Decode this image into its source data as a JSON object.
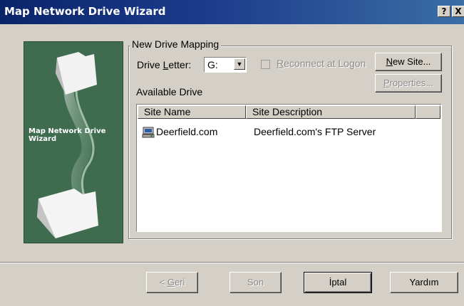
{
  "window": {
    "title": "Map Network Drive Wizard",
    "help_button": "?",
    "close_button": "X"
  },
  "side_panel": {
    "label": "Map Network Drive Wizard",
    "background_color": "#3f6b4f"
  },
  "group": {
    "title": "New Drive Mapping",
    "drive_letter_label_before": "Drive ",
    "drive_letter_label_hotkey": "L",
    "drive_letter_label_after": "etter:",
    "drive_letter_value": "G:",
    "reconnect_hotkey": "R",
    "reconnect_label": "econnect at Logon",
    "reconnect_checked": false,
    "new_site_hotkey": "N",
    "new_site_label": "ew Site...",
    "properties_hotkey": "P",
    "properties_label": "roperties...",
    "available_drive_label": "Available Drive"
  },
  "list": {
    "columns": [
      "Site Name",
      "Site Description"
    ],
    "rows": [
      {
        "icon": "network-drive-icon",
        "site_name": "Deerfield.com",
        "site_description": "Deerfield.com's FTP Server"
      }
    ]
  },
  "footer": {
    "back_prefix": "< ",
    "back_hotkey": "G",
    "back_label": "eri",
    "finish_label": "Son",
    "cancel_label": "İptal",
    "help_label": "Yardım"
  },
  "colors": {
    "title_bar_start": "#0a246a",
    "title_bar_end": "#3a6ea5",
    "dialog_face": "#d4d0c8"
  }
}
